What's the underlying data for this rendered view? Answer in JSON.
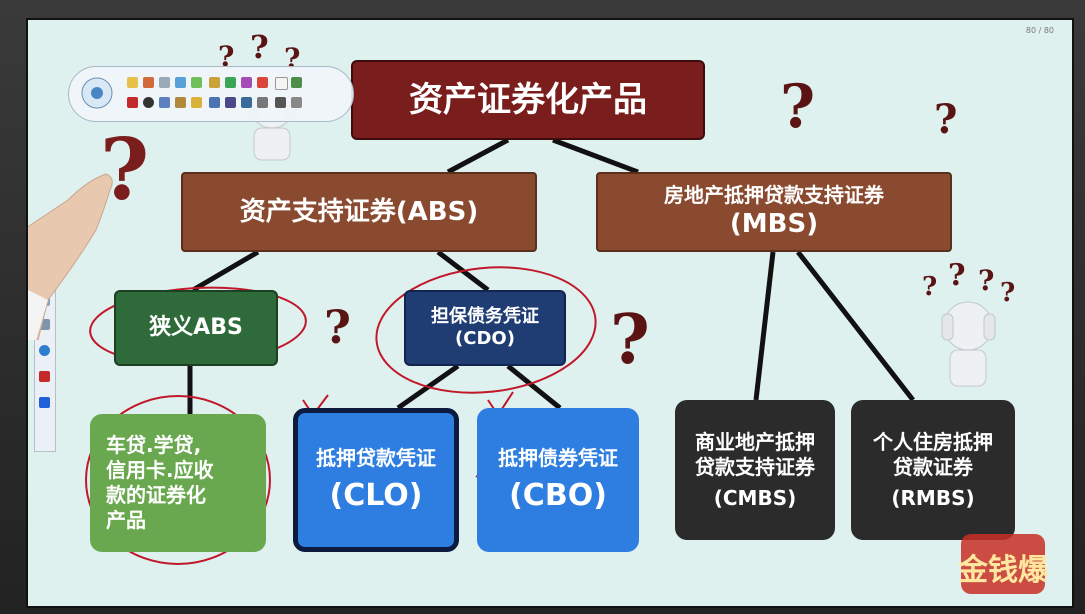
{
  "page_indicator": "80 / 80",
  "diagram": {
    "root": "资产证券化产品",
    "abs": {
      "label": "资产支持证券(ABS)"
    },
    "mbs": {
      "line1": "房地产抵押贷款支持证券",
      "line2": "(MBS)"
    },
    "narrow_abs": "狭义ABS",
    "cdo": {
      "line1": "担保债务凭证",
      "line2": "(CDO)"
    },
    "loans": {
      "line1": "车贷.学贷,",
      "line2": "信用卡.应收",
      "line3": "款的证券化",
      "line4": "产品"
    },
    "clo": {
      "line1": "抵押贷款凭证",
      "line2": "(CLO)"
    },
    "cbo": {
      "line1": "抵押债券凭证",
      "line2": "(CBO)"
    },
    "cmbs": {
      "line1": "商业地产抵押",
      "line2": "贷款支持证券",
      "line3": "(CMBS)"
    },
    "rmbs": {
      "line1": "个人住房抵押",
      "line2": "贷款证券",
      "line3": "(RMBS)"
    }
  },
  "question_mark": "?",
  "logo_text": "金钱爆",
  "colors": {
    "root": "#7a1d1d",
    "brown": "#8a4a2f",
    "green_dark": "#2f6a3a",
    "navy": "#1f3d73",
    "green_light": "#6aa84f",
    "blue": "#2d7ee0",
    "charcoal": "#2c2b2b",
    "annotation_red": "#c0182a"
  }
}
